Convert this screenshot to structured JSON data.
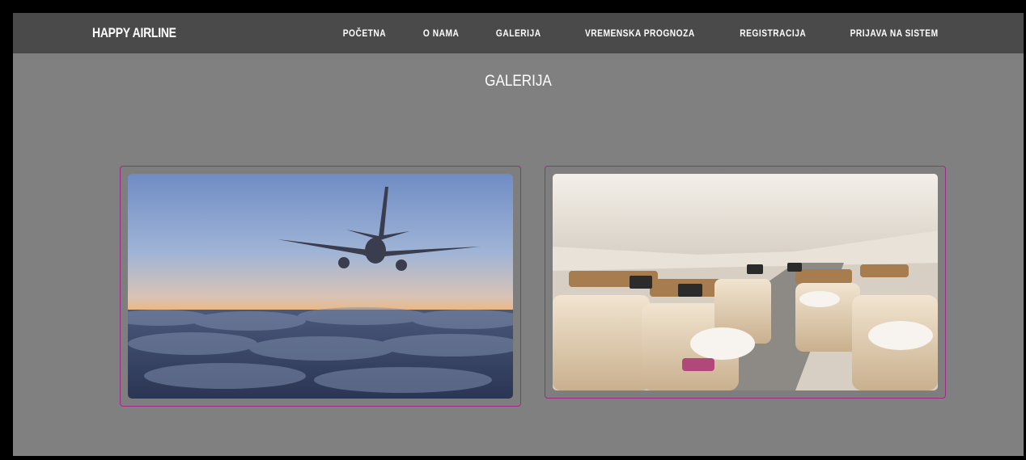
{
  "brand": "HAPPY AIRLINE",
  "nav": [
    {
      "label": "POČETNA"
    },
    {
      "label": "O NAMA"
    },
    {
      "label": "GALERIJA"
    },
    {
      "label": "VREMENSKA PROGNOZA"
    },
    {
      "label": "REGISTRACIJA"
    },
    {
      "label": "PRIJAVA NA SISTEM"
    }
  ],
  "page_title": "GALERIJA",
  "colors": {
    "navbar_bg": "#4a4a4a",
    "page_bg": "#808080",
    "card_border": "#a02a8a"
  }
}
